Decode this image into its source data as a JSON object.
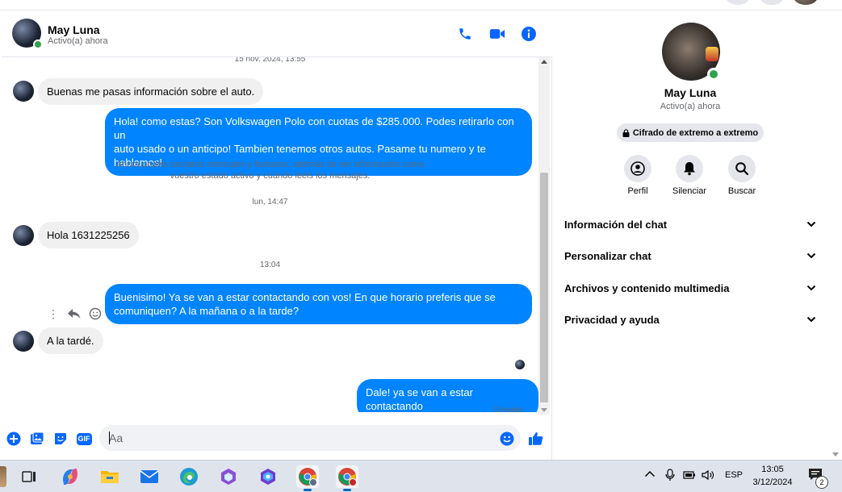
{
  "colors": {
    "accent": "#0084ff",
    "icon_blue": "#0866ff",
    "incoming_bubble": "#f0f0f0",
    "online": "#31a24c",
    "muted_text": "#65676b"
  },
  "header": {
    "name": "May Luna",
    "status": "Activo(a) ahora",
    "icons": [
      "phone-icon",
      "video-camera-icon",
      "info-icon"
    ]
  },
  "messages": {
    "timestamp_1": "15 nov. 2024, 13:55",
    "msg_1": "Buenas me pasas información sobre el auto.",
    "msg_2_line1": "Hola! como estas? Son Volkswagen Polo con cuotas de $285.000. Podes retirarlo con un",
    "msg_2_line2": "auto usado o un anticipo! Tambien tenemos otros autos. Pasame tu numero y te hablamos!",
    "notice_line1": "Ahora podéis enviaros mensajes y llamaros, además de ver información como",
    "notice_line2": "vuestro estado activo y cuándo leéis los mensajes.",
    "timestamp_2": "lun, 14:47",
    "msg_3": "Hola 1631225256",
    "timestamp_3": "13:04",
    "msg_4_line1": "Buenisimo! Ya se van a estar contactando con vos! En que horario preferis que se",
    "msg_4_line2": "comuniquen? A la mañana o a la tarde?",
    "msg_5": "A la tardé.",
    "msg_6": "Dale! ya se van a estar contactando",
    "delivery_status": "Enviado"
  },
  "composer": {
    "placeholder": "Aa",
    "gif_label": "GIF",
    "icons": [
      "plus-icon",
      "image-icon",
      "sticker-icon",
      "gif-icon",
      "emoji-icon",
      "thumbs-up-icon"
    ]
  },
  "panel": {
    "name": "May Luna",
    "status": "Activo(a) ahora",
    "encryption": "Cifrado de extremo a extremo",
    "actions": [
      {
        "label": "Perfil",
        "icon": "profile-icon"
      },
      {
        "label": "Silenciar",
        "icon": "bell-icon"
      },
      {
        "label": "Buscar",
        "icon": "search-icon"
      }
    ],
    "sections": [
      "Información del chat",
      "Personalizar chat",
      "Archivos y contenido multimedia",
      "Privacidad y ayuda"
    ]
  },
  "taskbar": {
    "language": "ESP",
    "time": "13:05",
    "date": "3/12/2024",
    "notification_count": "2",
    "apps": [
      "task-view-icon",
      "copilot-icon",
      "file-explorer-icon",
      "mail-icon",
      "edge-icon",
      "office-icon",
      "teams-icon",
      "chrome-profile-icon",
      "chrome-icon"
    ]
  }
}
